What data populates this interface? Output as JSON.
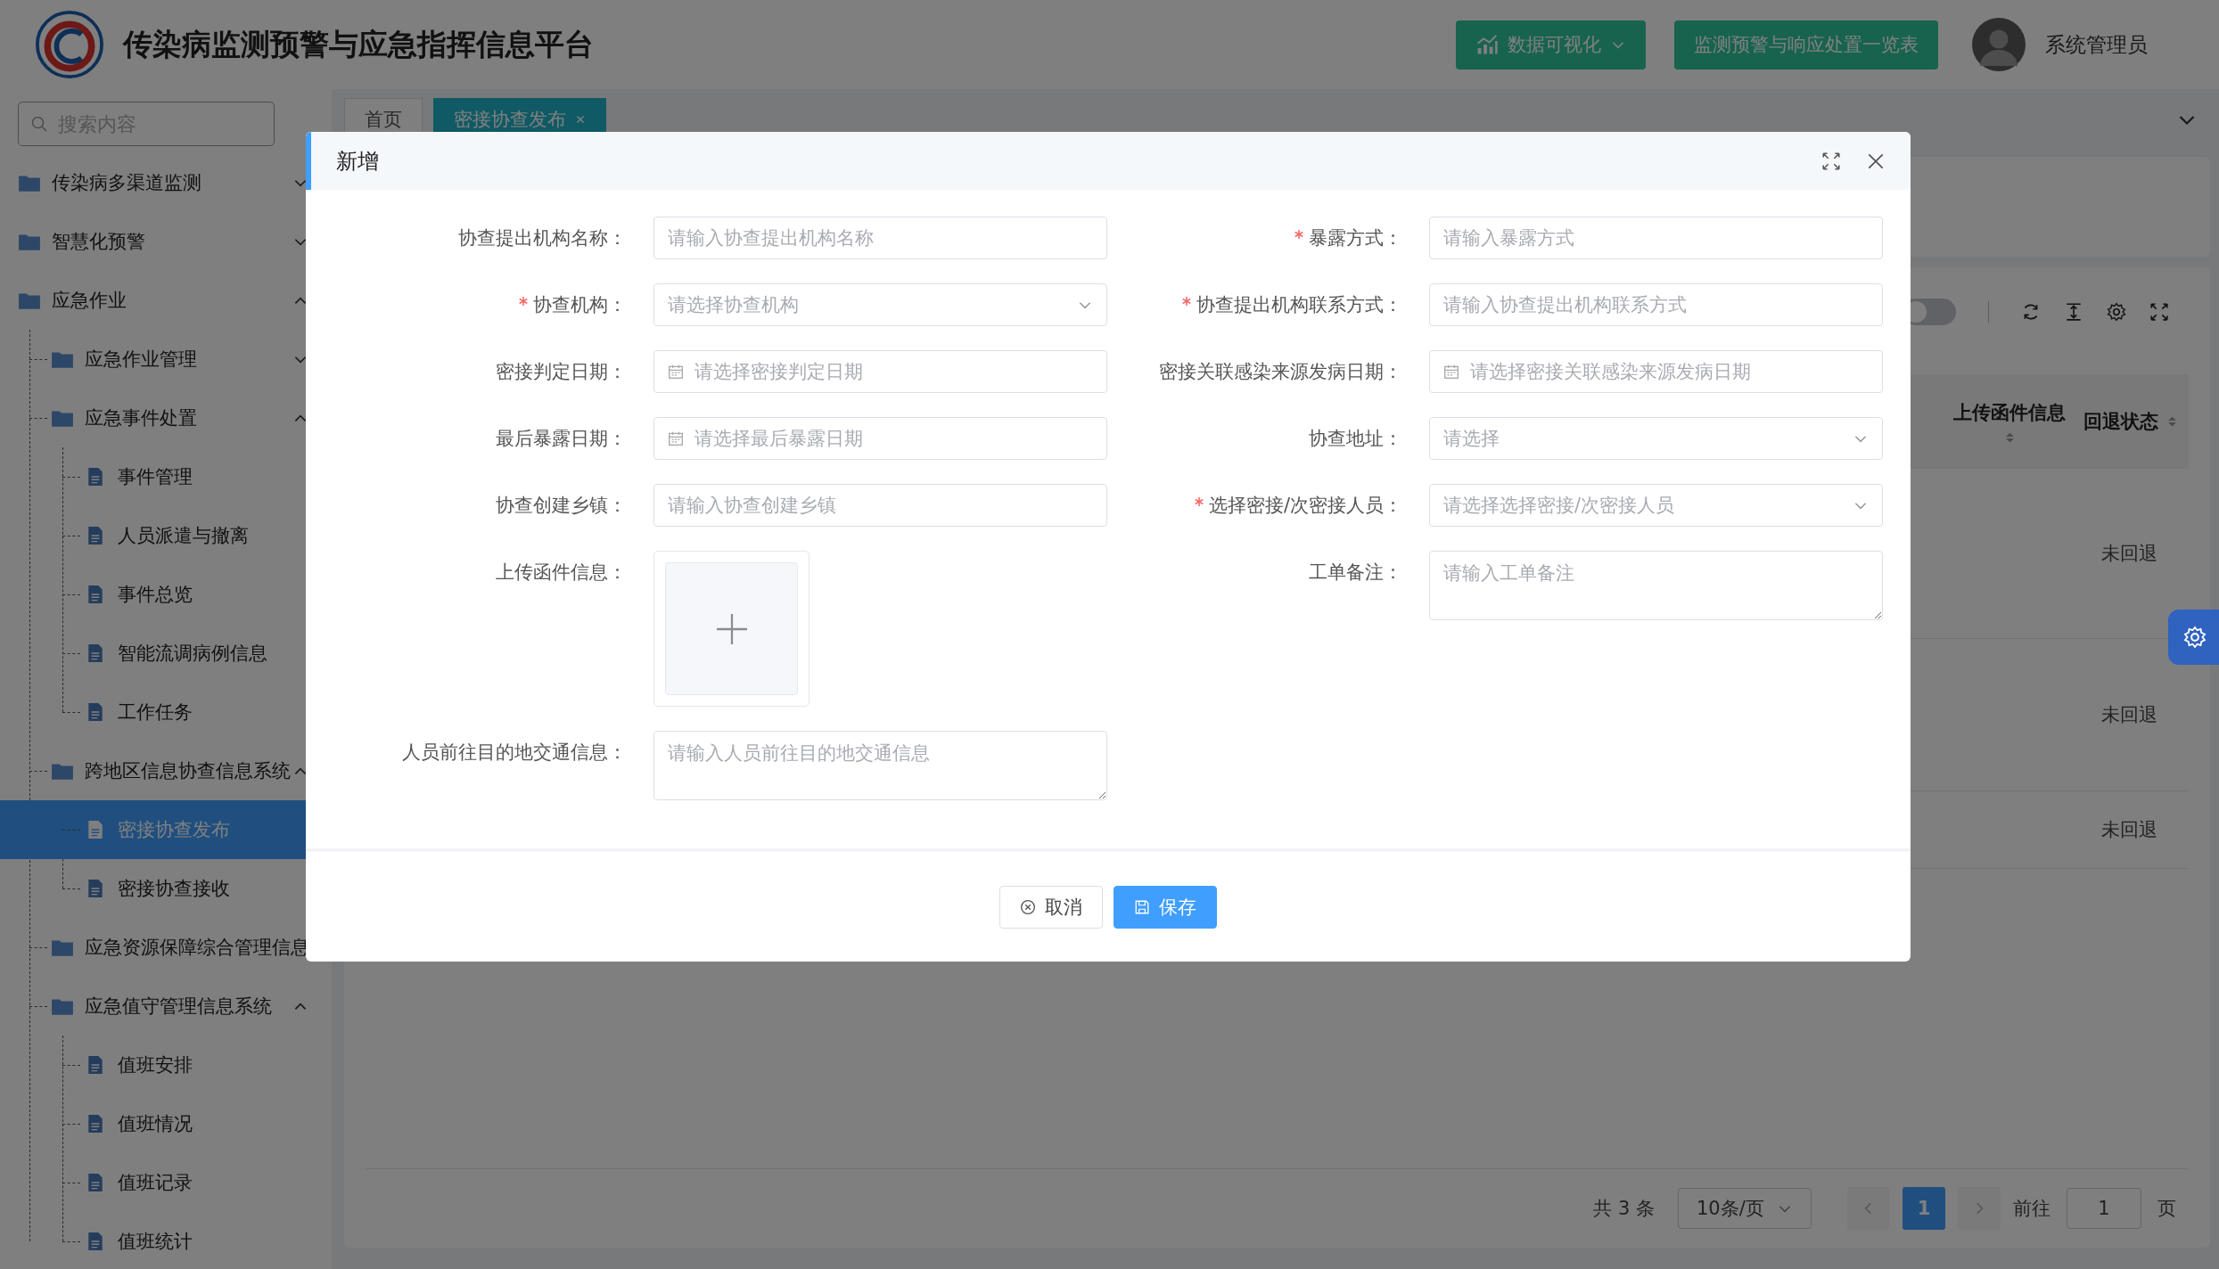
{
  "header": {
    "title": "传染病监测预警与应急指挥信息平台",
    "buttons": [
      {
        "label": "数据可视化",
        "kind": "menu"
      },
      {
        "label": "监测预警与响应处置一览表",
        "kind": "plain"
      }
    ],
    "user": "系统管理员"
  },
  "sidebar": {
    "search": {
      "placeholder": "搜索内容"
    },
    "items": [
      {
        "label": "传染病多渠道监测",
        "kind": "folder",
        "expanded": false,
        "selected": false
      },
      {
        "label": "智慧化预警",
        "kind": "folder",
        "expanded": false,
        "selected": false
      },
      {
        "label": "应急作业",
        "kind": "folder",
        "expanded": true,
        "selected": false,
        "children": [
          {
            "label": "应急作业管理",
            "kind": "folder",
            "expanded": false,
            "selected": false
          },
          {
            "label": "应急事件处置",
            "kind": "folder",
            "expanded": true,
            "selected": false,
            "children": [
              {
                "label": "事件管理",
                "kind": "page",
                "selected": false
              },
              {
                "label": "人员派遣与撤离",
                "kind": "page",
                "selected": false
              },
              {
                "label": "事件总览",
                "kind": "page",
                "selected": false
              },
              {
                "label": "智能流调病例信息",
                "kind": "page",
                "selected": false
              },
              {
                "label": "工作任务",
                "kind": "page",
                "selected": false
              }
            ]
          },
          {
            "label": "跨地区信息协查信息系统",
            "kind": "folder",
            "expanded": true,
            "selected": false,
            "children": [
              {
                "label": "密接协查发布",
                "kind": "page",
                "selected": true
              },
              {
                "label": "密接协查接收",
                "kind": "page",
                "selected": false
              }
            ]
          },
          {
            "label": "应急资源保障综合管理信息",
            "kind": "folder",
            "selected": false
          },
          {
            "label": "应急值守管理信息系统",
            "kind": "folder",
            "expanded": true,
            "selected": false,
            "children": [
              {
                "label": "值班安排",
                "kind": "page",
                "selected": false
              },
              {
                "label": "值班情况",
                "kind": "page",
                "selected": false
              },
              {
                "label": "值班记录",
                "kind": "page",
                "selected": false
              },
              {
                "label": "值班统计",
                "kind": "page",
                "selected": false
              }
            ]
          }
        ]
      }
    ]
  },
  "tabs": [
    {
      "label": "首页",
      "selected": false,
      "closable": false
    },
    {
      "label": "密接协查发布",
      "selected": true,
      "closable": true
    }
  ],
  "toolbar": {
    "switch": {
      "on": false
    }
  },
  "table": {
    "columns": [
      "上传函件信息",
      "回退状态"
    ],
    "rows": [
      {
        "status": "未回退"
      },
      {
        "status": "未回退"
      },
      {
        "status": "未回退"
      }
    ]
  },
  "pagination": {
    "total": "共 3 条",
    "page_size": "10条/页",
    "pages": [
      {
        "label": "1",
        "selected": true
      }
    ],
    "goto_label": "前往",
    "goto_value": "1",
    "goto_suffix": "页"
  },
  "modal": {
    "title": "新增",
    "fields": [
      {
        "label": "协查提出机构名称：",
        "kind": "input",
        "required": false,
        "placeholder": "请输入协查提出机构名称"
      },
      {
        "label": "暴露方式：",
        "kind": "input",
        "required": true,
        "placeholder": "请输入暴露方式"
      },
      {
        "label": "协查机构：",
        "kind": "select",
        "required": true,
        "placeholder": "请选择协查机构"
      },
      {
        "label": "协查提出机构联系方式：",
        "kind": "input",
        "required": true,
        "placeholder": "请输入协查提出机构联系方式"
      },
      {
        "label": "密接判定日期：",
        "kind": "date",
        "required": false,
        "placeholder": "请选择密接判定日期"
      },
      {
        "label": "密接关联感染来源发病日期：",
        "kind": "date",
        "required": false,
        "placeholder": "请选择密接关联感染来源发病日期"
      },
      {
        "label": "最后暴露日期：",
        "kind": "date",
        "required": false,
        "placeholder": "请选择最后暴露日期"
      },
      {
        "label": "协查地址：",
        "kind": "select",
        "required": false,
        "placeholder": "请选择"
      },
      {
        "label": "协查创建乡镇：",
        "kind": "input",
        "required": false,
        "placeholder": "请输入协查创建乡镇"
      },
      {
        "label": "选择密接/次密接人员：",
        "kind": "select",
        "required": true,
        "placeholder": "请选择选择密接/次密接人员"
      },
      {
        "label": "上传函件信息：",
        "kind": "upload",
        "required": false
      },
      {
        "label": "工单备注：",
        "kind": "textarea",
        "required": false,
        "placeholder": "请输入工单备注"
      },
      {
        "label": "人员前往目的地交通信息：",
        "kind": "textarea",
        "required": false,
        "placeholder": "请输入人员前往目的地交通信息"
      }
    ],
    "buttons": [
      {
        "label": "取消",
        "kind": "cancel"
      },
      {
        "label": "保存",
        "kind": "save"
      }
    ]
  }
}
